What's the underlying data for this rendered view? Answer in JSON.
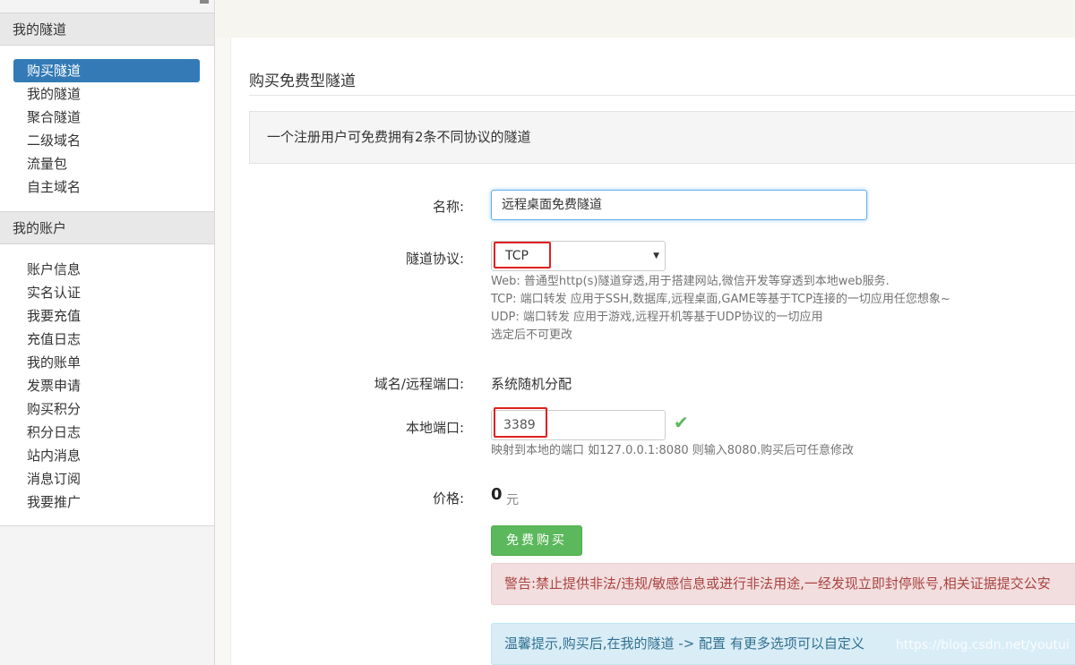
{
  "sidebar": {
    "sections": [
      {
        "heading": "我的隧道",
        "items": [
          {
            "label": "购买隧道",
            "active": true
          },
          {
            "label": "我的隧道"
          },
          {
            "label": "聚合隧道"
          },
          {
            "label": "二级域名"
          },
          {
            "label": "流量包"
          },
          {
            "label": "自主域名"
          }
        ]
      },
      {
        "heading": "我的账户",
        "items": [
          {
            "label": "账户信息"
          },
          {
            "label": "实名认证"
          },
          {
            "label": "我要充值"
          },
          {
            "label": "充值日志"
          },
          {
            "label": "我的账单"
          },
          {
            "label": "发票申请"
          },
          {
            "label": "购买积分"
          },
          {
            "label": "积分日志"
          },
          {
            "label": "站内消息"
          },
          {
            "label": "消息订阅"
          },
          {
            "label": "我要推广"
          }
        ]
      }
    ]
  },
  "page": {
    "title": "购买免费型隧道",
    "info": "一个注册用户可免费拥有2条不同协议的隧道"
  },
  "form": {
    "name_label": "名称:",
    "name_value": "远程桌面免费隧道",
    "protocol_label": "隧道协议:",
    "protocol_value": "TCP",
    "protocol_help": [
      "Web: 普通型http(s)隧道穿透,用于搭建网站,微信开发等穿透到本地web服务.",
      "TCP: 端口转发 应用于SSH,数据库,远程桌面,GAME等基于TCP连接的一切应用任您想象~",
      "UDP: 端口转发 应用于游戏,远程开机等基于UDP协议的一切应用",
      "选定后不可更改"
    ],
    "domain_label": "域名/远程端口:",
    "domain_value": "系统随机分配",
    "local_port_label": "本地端口:",
    "local_port_value": "3389",
    "local_port_help": "映射到本地的端口 如127.0.0.1:8080 则输入8080.购买后可任意修改",
    "price_label": "价格:",
    "price_value": "0",
    "price_unit": "元",
    "buy_button": "免费购买"
  },
  "alerts": {
    "warning": "警告:禁止提供非法/违规/敏感信息或进行非法用途,一经发现立即封停账号,相关证据提交公安",
    "tip": "温馨提示,购买后,在我的隧道 -> 配置 有更多选项可以自定义"
  },
  "watermark": "https://blog.csdn.net/youtui",
  "colors": {
    "active_nav": "#337ab7",
    "buy_button": "#5cb85c",
    "warning_bg": "#f2dede",
    "tip_bg": "#d9edf7",
    "highlight_box": "#e02020"
  },
  "icons": {
    "valid_check": "check-icon",
    "select_caret": "caret-down-icon"
  }
}
